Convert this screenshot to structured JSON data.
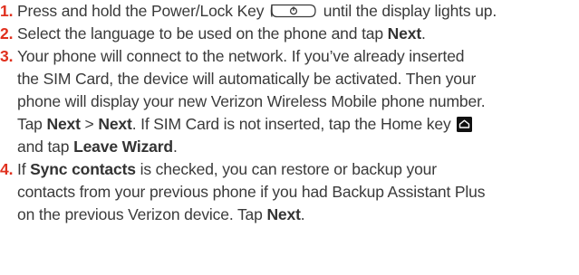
{
  "steps": [
    {
      "number": "1.",
      "line1_before": "Press and hold the Power/Lock Key",
      "line1_after": "until the display lights up.",
      "power_key_glyph": "power-key-icon"
    },
    {
      "number": "2.",
      "line1_before": "Select the language to be used on the phone and tap",
      "line1_bold": "Next",
      "line1_after": "."
    },
    {
      "number": "3.",
      "line1": "Your phone will connect to the network. If you’ve already inserted",
      "line2": "the SIM Card, the device will automatically be activated. Then your",
      "line3": "phone will display your new Verizon Wireless Mobile phone number.",
      "line4_a": "Tap",
      "line4_bold1": "Next",
      "line4_sep": ">",
      "line4_bold2": "Next",
      "line4_b": ". If SIM Card is not inserted, tap the Home key",
      "line5_a": "and tap",
      "line5_bold": "Leave Wizard",
      "line5_b": ".",
      "home_key_glyph": "home-key-icon"
    },
    {
      "number": "4.",
      "line1_a": "If",
      "line1_bold": "Sync contacts",
      "line1_b": "is checked, you can restore or backup your",
      "line2": "contacts from your previous phone if you had Backup Assistant Plus",
      "line3_a": "on the previous Verizon device. Tap",
      "line3_bold": "Next",
      "line3_b": "."
    }
  ],
  "colors": {
    "number": "#e0301e",
    "text": "#3a3a3a"
  }
}
